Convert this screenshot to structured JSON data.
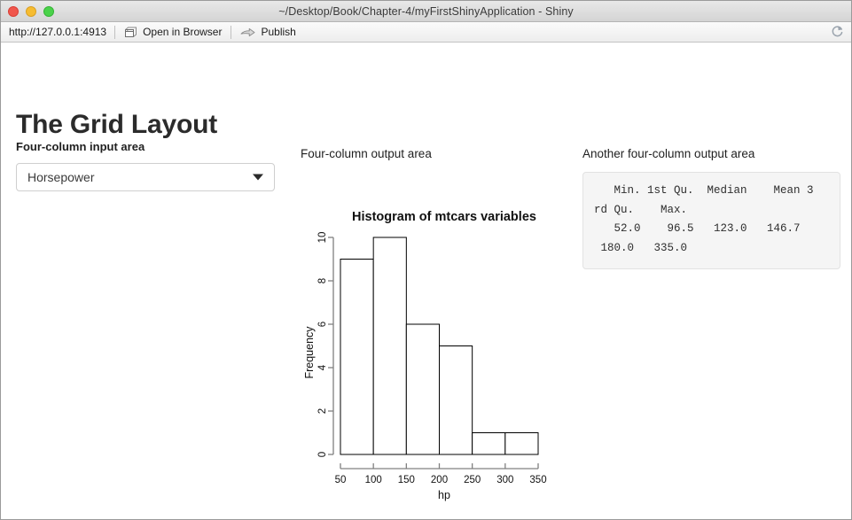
{
  "window": {
    "title": "~/Desktop/Book/Chapter-4/myFirstShinyApplication - Shiny",
    "traffic_lights": [
      "close",
      "minimize",
      "zoom"
    ]
  },
  "toolbar": {
    "url": "http://127.0.0.1:4913",
    "open_in_browser_label": "Open in Browser",
    "open_in_browser_icon": "browser-window-icon",
    "publish_label": "Publish",
    "publish_icon": "arrow-publish-icon",
    "refresh_icon": "refresh-icon"
  },
  "page": {
    "title": "The Grid Layout"
  },
  "input_column": {
    "heading": "Four-column input area",
    "select": {
      "value": "Horsepower",
      "placeholder": "Horsepower",
      "caret_icon": "chevron-down-icon"
    }
  },
  "plot_column": {
    "heading": "Four-column output area"
  },
  "summary_column": {
    "heading": "Another four-column output area",
    "summary_lines": [
      "   Min. 1st Qu.  Median    Mean 3",
      "rd Qu.    Max. ",
      "   52.0    96.5   123.0   146.7 ",
      " 180.0   335.0 "
    ],
    "summary_text": "   Min. 1st Qu.  Median    Mean 3\nrd Qu.    Max. \n   52.0    96.5   123.0   146.7 \n 180.0   335.0 ",
    "stat_names": [
      "Min.",
      "1st Qu.",
      "Median",
      "Mean",
      "3rd Qu.",
      "Max."
    ],
    "stat_values": [
      "52.0",
      "96.5",
      "123.0",
      "146.7",
      "180.0",
      "335.0"
    ]
  },
  "chart_data": {
    "type": "bar",
    "title": "Histogram of mtcars variables",
    "xlabel": "hp",
    "ylabel": "Frequency",
    "categories": [
      "50-100",
      "100-150",
      "150-200",
      "200-250",
      "250-300",
      "300-350"
    ],
    "bin_edges": [
      50,
      100,
      150,
      200,
      250,
      300,
      350
    ],
    "values": [
      9,
      10,
      6,
      5,
      1,
      1
    ],
    "x_ticks": [
      50,
      100,
      150,
      200,
      250,
      300,
      350
    ],
    "y_ticks": [
      0,
      2,
      4,
      6,
      8,
      10
    ],
    "xlim": [
      50,
      350
    ],
    "ylim": [
      0,
      10
    ],
    "grid": false,
    "legend": "none",
    "bar_fill": "#ffffff",
    "bar_stroke": "#000000",
    "axis_color": "#808080"
  },
  "colors": {
    "titlebar_top": "#e8e8e8",
    "titlebar_bottom": "#d4d4d4",
    "toolbar_bottom": "#ededed",
    "page_bg": "#ffffff",
    "summary_bg": "#f5f5f5",
    "summary_border": "#e2e2e2",
    "text": "#1f1f1f",
    "close_light": "#f0564c",
    "min_light": "#f6bc31",
    "zoom_light": "#4ad24a"
  }
}
